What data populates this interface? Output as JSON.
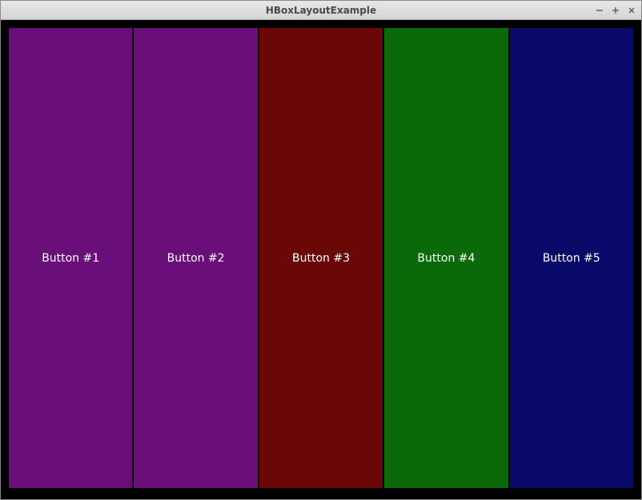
{
  "window": {
    "title": "HBoxLayoutExample"
  },
  "buttons": [
    {
      "label": "Button #1",
      "color": "#6a0f79"
    },
    {
      "label": "Button #2",
      "color": "#6a0f79"
    },
    {
      "label": "Button #3",
      "color": "#6a0808"
    },
    {
      "label": "Button #4",
      "color": "#0a6a0a"
    },
    {
      "label": "Button #5",
      "color": "#0a0a6a"
    }
  ]
}
